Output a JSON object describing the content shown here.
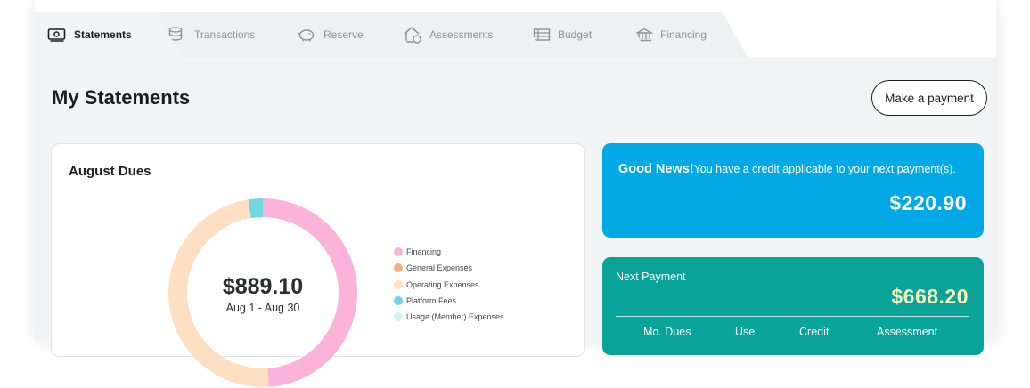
{
  "tabs": [
    {
      "label": "Statements",
      "icon": "statement-icon",
      "active": true
    },
    {
      "label": "Transactions",
      "icon": "coins-stack-icon",
      "active": false
    },
    {
      "label": "Reserve",
      "icon": "piggy-bank-icon",
      "active": false
    },
    {
      "label": "Assessments",
      "icon": "house-dollar-icon",
      "active": false
    },
    {
      "label": "Budget",
      "icon": "budget-sheet-icon",
      "active": false
    },
    {
      "label": "Financing",
      "icon": "bank-building-icon",
      "active": false
    }
  ],
  "page": {
    "title": "My Statements",
    "pay_button": "Make a payment"
  },
  "dues": {
    "title": "August Dues",
    "total": "$889.10",
    "range": "Aug 1 - Aug 30",
    "legend": [
      {
        "label": "Financing",
        "color": "#fcb3d9"
      },
      {
        "label": "General Expenses",
        "color": "#f7ad7a"
      },
      {
        "label": "Operating Expenses",
        "color": "#fde0c3"
      },
      {
        "label": "Platform Fees",
        "color": "#6fd6df"
      },
      {
        "label": "Usage (Member) Expenses",
        "color": "#cdf3f6"
      }
    ]
  },
  "chart_data": {
    "type": "pie",
    "style": "donut",
    "categories": [
      "Financing",
      "General Expenses",
      "Operating Expenses",
      "Platform Fees",
      "Usage (Member) Expenses"
    ],
    "values": [
      49,
      0,
      48.5,
      2.5,
      0
    ],
    "unit": "percent of total",
    "colors": [
      "#fcb3d9",
      "#f7ad7a",
      "#fde0c3",
      "#6fd6df",
      "#cdf3f6"
    ],
    "legend": "right"
  },
  "credit": {
    "headline": "Good News!",
    "message": "You have a credit applicable to your next payment(s).",
    "amount": "$220.90"
  },
  "next_payment": {
    "label": "Next Payment",
    "amount": "$668.20",
    "columns": [
      "Mo. Dues",
      "Use",
      "Credit",
      "Assessment"
    ]
  }
}
